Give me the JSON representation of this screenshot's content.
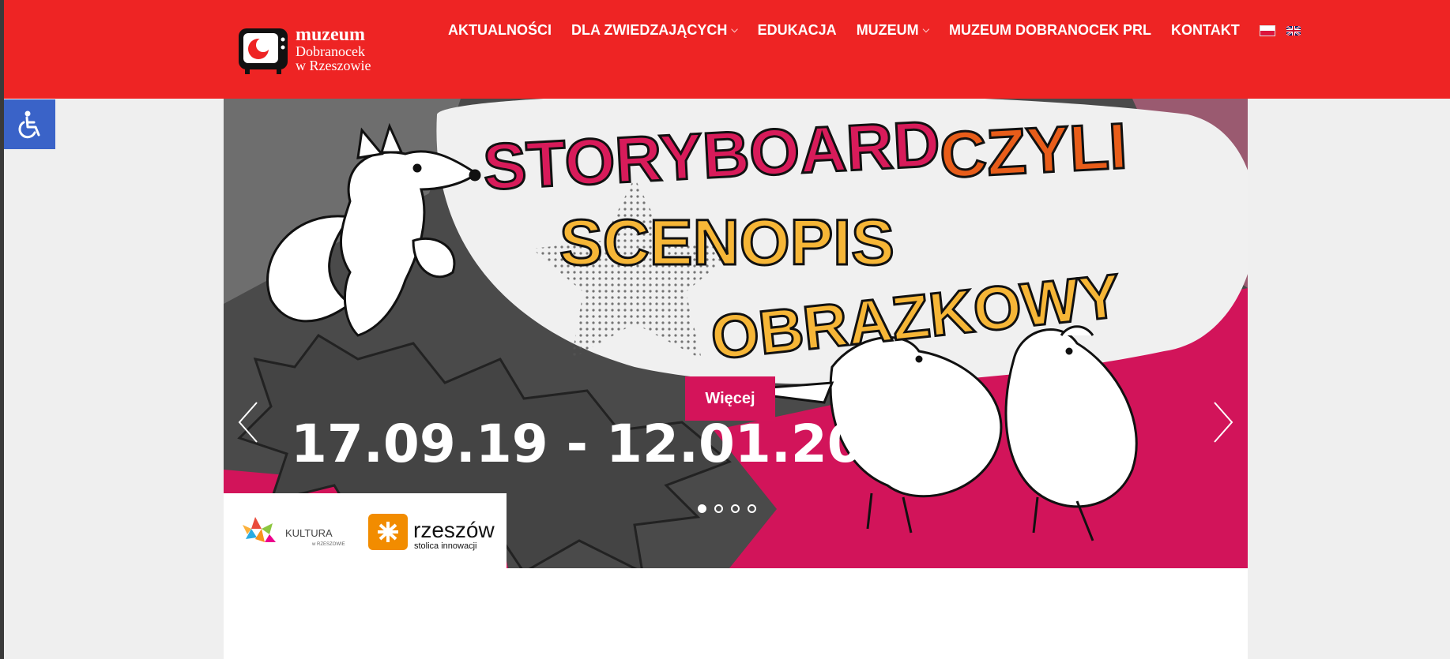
{
  "logo": {
    "line1": "muzeum",
    "line2": "Dobranocek",
    "line3": "w Rzeszowie"
  },
  "nav": [
    {
      "label": "AKTUALNOŚCI",
      "dropdown": false
    },
    {
      "label": "DLA ZWIEDZAJĄCYCH",
      "dropdown": true
    },
    {
      "label": "EDUKACJA",
      "dropdown": false
    },
    {
      "label": "MUZEUM",
      "dropdown": true
    },
    {
      "label": "MUZEUM DOBRANOCEK PRL",
      "dropdown": false
    },
    {
      "label": "KONTAKT",
      "dropdown": false
    }
  ],
  "languages": [
    "pl-flag",
    "en-flag"
  ],
  "accessibility": {
    "icon": "wheelchair-icon",
    "color": "#3a63c8"
  },
  "slider": {
    "title_line1a": "STORYBOARD",
    "title_line1b": "CZYLI",
    "title_line2": "SCENOPIS",
    "title_line3": "OBRAZKOWY",
    "dates": "17.09.19 - 12.01.20",
    "button": "Więcej",
    "slide_count": 4,
    "active_slide": 1,
    "sponsors": {
      "kultura": "KULTURA",
      "kultura_sub": "w RZESZOWIE",
      "rzeszow": "rzeszów",
      "rzeszow_sub": "stolica innowacji"
    }
  },
  "colors": {
    "header": "#ee2424",
    "accent": "#d4145a",
    "title_pink": "#d81b5a",
    "title_orange": "#e85d1a",
    "title_yellow": "#f6b637"
  }
}
